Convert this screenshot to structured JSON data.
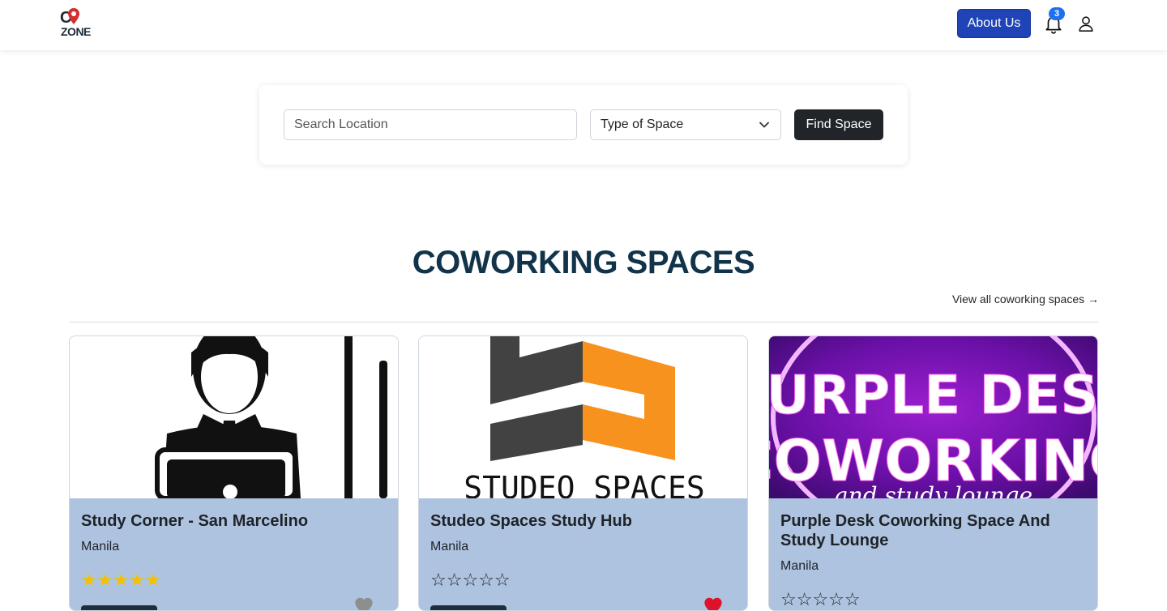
{
  "header": {
    "logo_text_top": "C",
    "logo_text_bottom": "ZONE",
    "about_label": "About Us",
    "notification_count": "3"
  },
  "search": {
    "location_placeholder": "Search Location",
    "type_label": "Type of Space",
    "find_label": "Find Space"
  },
  "section": {
    "title": "COWORKING SPACES",
    "view_all": "View all coworking spaces →"
  },
  "cards": [
    {
      "title": "Study Corner - San Marcelino",
      "city": "Manila",
      "rating": 5,
      "stars": "★★★★★",
      "favorite": false
    },
    {
      "title": "Studeo Spaces Study Hub",
      "city": "Manila",
      "rating": 0,
      "stars": "☆☆☆☆☆",
      "favorite": true,
      "image_text": "STUDEO SPACES"
    },
    {
      "title": "Purple Desk Coworking Space And Study Lounge",
      "city": "Manila",
      "rating": 0,
      "stars": "☆☆☆☆☆",
      "favorite": false,
      "image_text_1": "PURPLE DESK",
      "image_text_2": "COWORKING",
      "image_text_3": "and study lounge"
    }
  ],
  "colors": {
    "brand_blue": "#1f44b7",
    "title_navy": "#12344a",
    "card_bg": "#aec3e0",
    "star_gold": "#f2c200",
    "heart_red": "#e0112b",
    "heart_grey": "#8e8e8e"
  }
}
